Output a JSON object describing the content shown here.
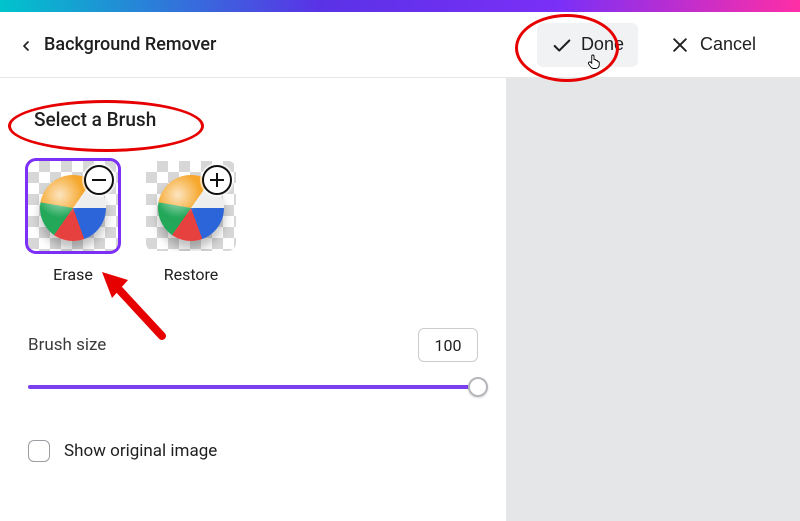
{
  "header": {
    "title": "Background Remover",
    "done_label": "Done",
    "cancel_label": "Cancel"
  },
  "panel": {
    "section_title": "Select a Brush",
    "brush_options": [
      {
        "label": "Erase",
        "selected": true
      },
      {
        "label": "Restore",
        "selected": false
      }
    ],
    "brush_size_label": "Brush size",
    "brush_size_value": "100",
    "brush_size_percent": 100,
    "show_original_label": "Show original image",
    "show_original_checked": false
  },
  "colors": {
    "accent": "#7b2ff7",
    "annotation": "#e60000"
  }
}
